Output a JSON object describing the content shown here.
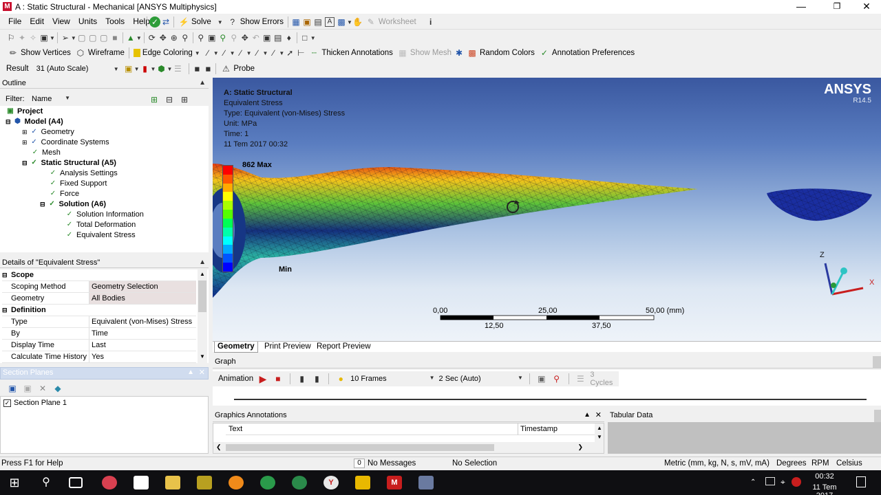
{
  "window": {
    "title": "A : Static Structural - Mechanical [ANSYS Multiphysics]",
    "app_icon_letter": "M"
  },
  "menu": [
    "File",
    "Edit",
    "View",
    "Units",
    "Tools",
    "Help"
  ],
  "toolbar1": {
    "solve": "Solve",
    "show_errors": "Show Errors",
    "worksheet": "Worksheet"
  },
  "toolbar3": {
    "show_vertices": "Show Vertices",
    "wireframe": "Wireframe",
    "edge_coloring": "Edge Coloring",
    "thicken_annotations": "Thicken Annotations",
    "show_mesh": "Show Mesh",
    "random_colors": "Random Colors",
    "annotation_preferences": "Annotation Preferences"
  },
  "toolbar4": {
    "result_label": "Result",
    "result_value": "31 (Auto Scale)",
    "probe": "Probe"
  },
  "outline": {
    "title": "Outline",
    "filter_label": "Filter:",
    "filter_value": "Name",
    "tree": [
      "Project",
      "Model (A4)",
      "Geometry",
      "Coordinate Systems",
      "Mesh",
      "Static Structural (A5)",
      "Analysis Settings",
      "Fixed Support",
      "Force",
      "Solution (A6)",
      "Solution Information",
      "Total Deformation",
      "Equivalent Stress"
    ]
  },
  "details": {
    "title": "Details of \"Equivalent Stress\"",
    "sections": [
      {
        "name": "Scope",
        "rows": [
          {
            "k": "Scoping Method",
            "v": "Geometry Selection"
          },
          {
            "k": "Geometry",
            "v": "All Bodies"
          }
        ]
      },
      {
        "name": "Definition",
        "rows": [
          {
            "k": "Type",
            "v": "Equivalent (von-Mises) Stress"
          },
          {
            "k": "By",
            "v": "Time"
          },
          {
            "k": "Display Time",
            "v": "Last"
          },
          {
            "k": "Calculate Time History",
            "v": "Yes"
          }
        ]
      }
    ]
  },
  "section_planes": {
    "title": "Section Planes",
    "item": "Section Plane 1"
  },
  "viewport": {
    "header": [
      "A: Static Structural",
      "Equivalent Stress",
      "Type: Equivalent (von-Mises) Stress",
      "Unit: MPa",
      "Time: 1",
      "11 Tem 2017 00:32"
    ],
    "max_label": "862 Max",
    "min_label": "Min",
    "brand": "ANSYS",
    "version": "R14.5",
    "scale_top": [
      "0,00",
      "25,00",
      "50,00 (mm)"
    ],
    "scale_bottom": [
      "12,50",
      "37,50"
    ],
    "axis_z": "Z",
    "axis_x": "X"
  },
  "tabs": [
    "Geometry",
    "Print Preview",
    "Report Preview"
  ],
  "graph": {
    "title": "Graph",
    "animation": "Animation",
    "frames": "10 Frames",
    "duration": "2 Sec (Auto)",
    "cycles": "3 Cycles"
  },
  "annotations": {
    "title": "Graphics Annotations",
    "col_text": "Text",
    "col_timestamp": "Timestamp"
  },
  "tabular": {
    "title": "Tabular Data"
  },
  "status": {
    "help": "Press F1 for Help",
    "messages_count": "0",
    "messages": "No Messages",
    "selection": "No Selection",
    "units": "Metric (mm, kg, N, s, mV, mA)",
    "degrees": "Degrees",
    "rpm": "RPM",
    "celsius": "Celsius"
  },
  "taskbar": {
    "time": "00:32",
    "date": "11 Tem 2017"
  },
  "colors": {
    "legend": [
      "#ff0000",
      "#ff5500",
      "#ffaa00",
      "#ffff00",
      "#aaff00",
      "#55ff00",
      "#00ff55",
      "#00ffaa",
      "#00ffff",
      "#00aaff",
      "#0055ff",
      "#0000ff"
    ]
  }
}
